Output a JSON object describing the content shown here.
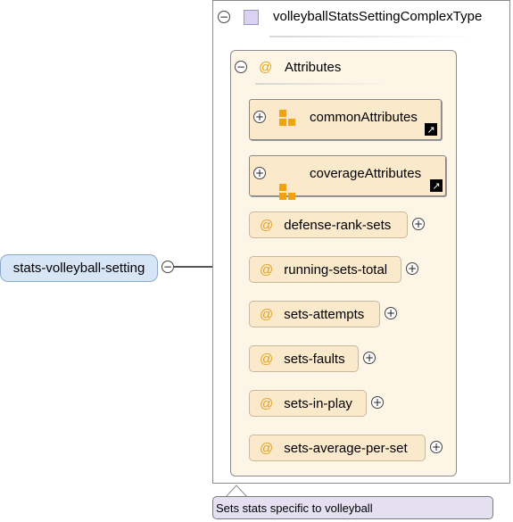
{
  "root": {
    "label": "stats-volleyball-setting"
  },
  "type": {
    "name": "volleyballStatsSettingComplexType"
  },
  "attributes_group": {
    "label": "Attributes",
    "at_glyph": "@"
  },
  "group_refs": [
    {
      "label": "commonAttributes"
    },
    {
      "label": "coverageAttributes"
    }
  ],
  "attributes": [
    {
      "label": "defense-rank-sets"
    },
    {
      "label": "running-sets-total"
    },
    {
      "label": "sets-attempts"
    },
    {
      "label": "sets-faults"
    },
    {
      "label": "sets-in-play"
    },
    {
      "label": "sets-average-per-set"
    }
  ],
  "annotation": {
    "text": "Sets stats specific to volleyball"
  },
  "glyphs": {
    "minus": "−",
    "plus": "+",
    "shortcut": "↗"
  },
  "colors": {
    "root_fill": "#d7e6f7",
    "attr_fill": "#fbe9cc",
    "group_fill": "#fdf5e6",
    "at_color": "#e1a21b",
    "annotation_fill": "#e4e0f1"
  }
}
